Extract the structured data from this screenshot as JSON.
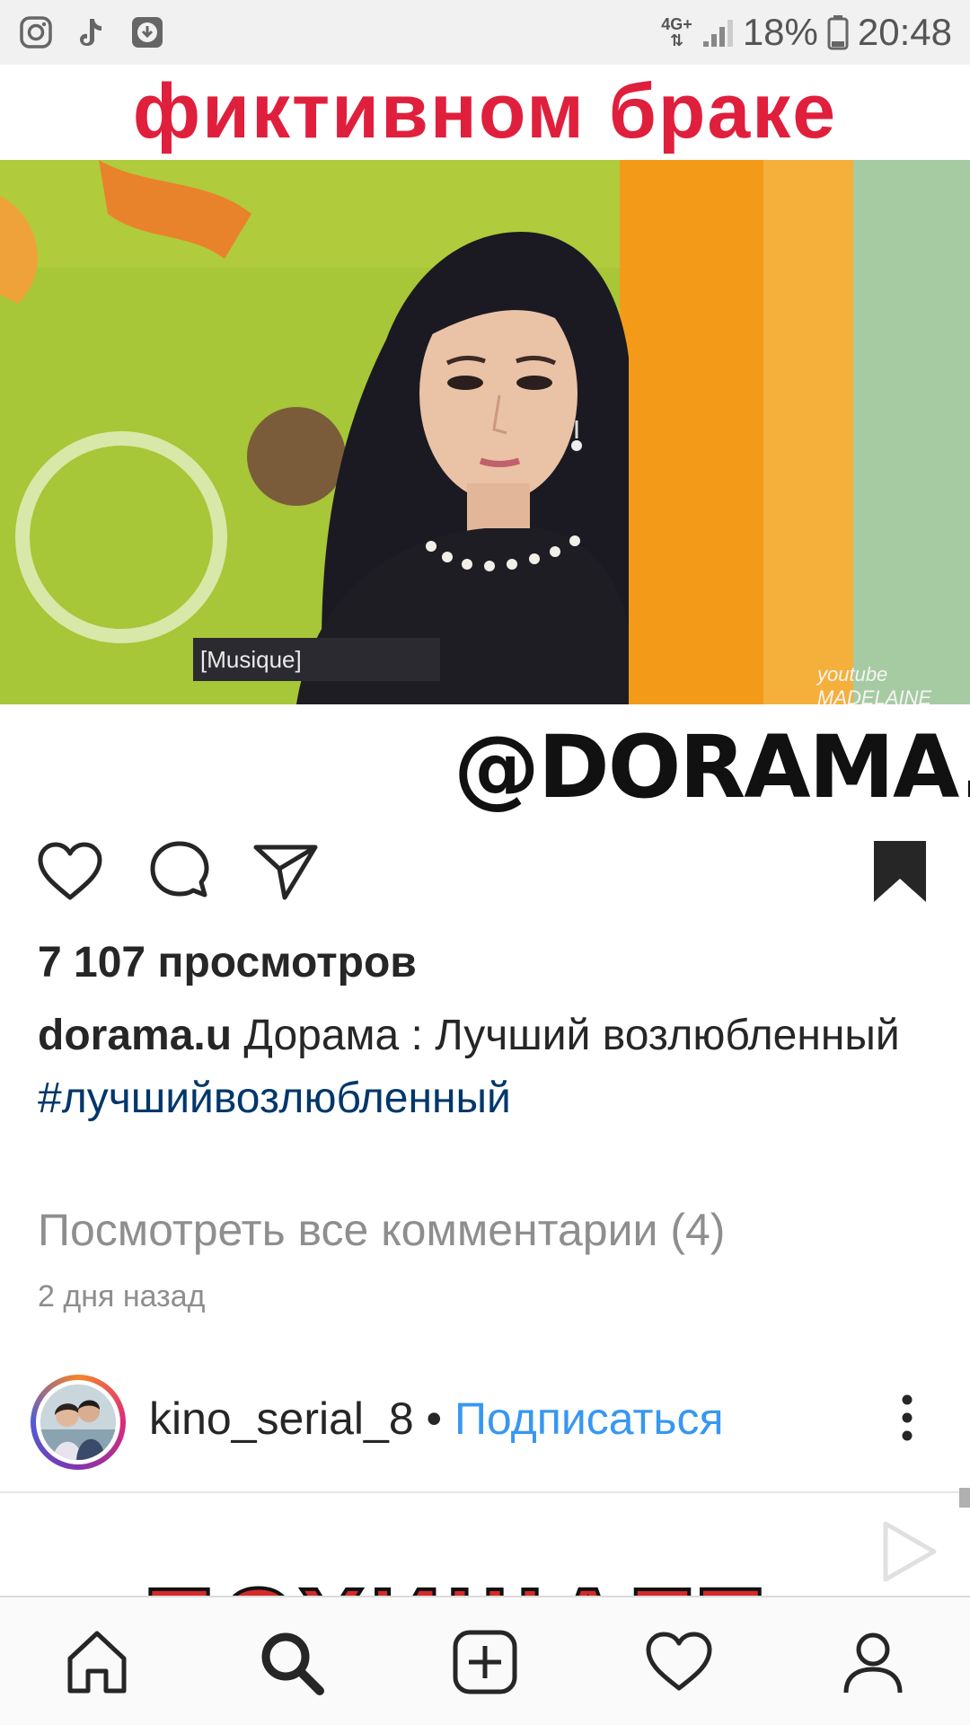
{
  "status_bar": {
    "left_icons": [
      "instagram-icon",
      "tiktok-icon",
      "download-icon"
    ],
    "network": "4G+",
    "battery_percent": "18%",
    "time": "20:48"
  },
  "post": {
    "overlay_title": "фиктивном  браке",
    "video_caption": "[Musique]",
    "watermark_signature": "youtube MADELAINE",
    "overlay_handle": "@DORAMA.U",
    "views": "7 107 просмотров",
    "author": "dorama.u",
    "caption_text": "Дорама : Лучший возлюбленный",
    "hashtag": "#лучшийвозлюбленный",
    "view_comments": "Посмотреть все комментарии (4)",
    "time_ago": "2 дня назад",
    "saved": true
  },
  "next_post": {
    "username": "kino_serial_8",
    "separator": "•",
    "follow_label": "Подписаться",
    "overlay_text_partial": "ПОХИЩАЕТ"
  },
  "bottom_nav": {
    "items": [
      "home-icon",
      "search-icon",
      "new-post-icon",
      "activity-heart-icon",
      "profile-icon"
    ],
    "active": "search-icon"
  },
  "colors": {
    "accent_blue": "#3897f0",
    "hashtag_blue": "#00376b",
    "title_red": "#e01f3d",
    "muted_gray": "#8e8e8e"
  }
}
